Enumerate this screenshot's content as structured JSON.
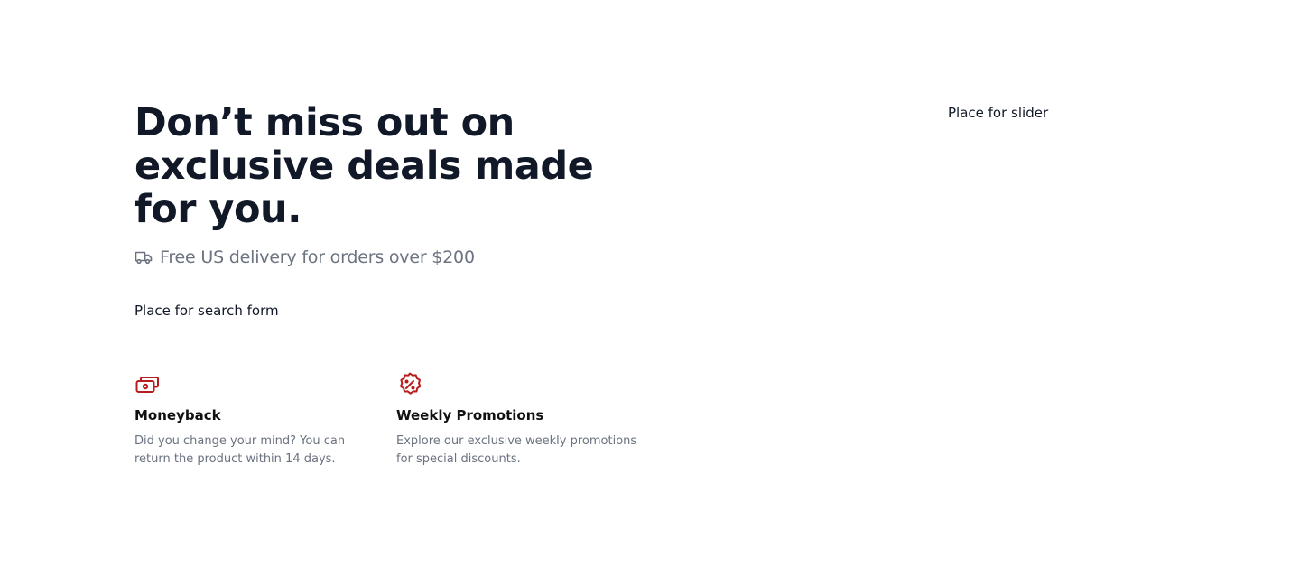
{
  "hero": {
    "headline": "Don’t miss out on exclusive deals made for you.",
    "delivery_icon": "truck-icon",
    "delivery_text": "Free US delivery for orders over $200",
    "search_placeholder": "Place for search form"
  },
  "features": [
    {
      "icon": "cash-icon",
      "title": "Moneyback",
      "description": "Did you change your mind? You can return the product within 14 days."
    },
    {
      "icon": "discount-badge-icon",
      "title": "Weekly Promotions",
      "description": "Explore our exclusive weekly promotions for special discounts."
    }
  ],
  "slider": {
    "placeholder": "Place for slider"
  },
  "colors": {
    "accent": "#b91c1c",
    "heading": "#111827",
    "muted": "#6b7280",
    "divider": "#e5e7eb"
  }
}
